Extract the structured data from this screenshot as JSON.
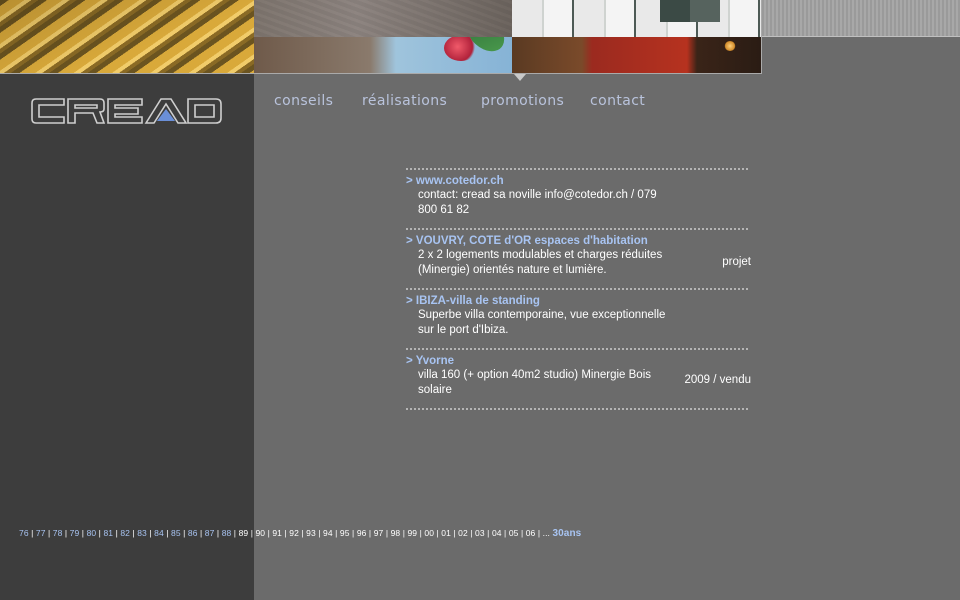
{
  "nav": {
    "items": [
      "conseils",
      "réalisations",
      "promotions",
      "contact"
    ],
    "active": "promotions"
  },
  "logo": {
    "text": "CREAD"
  },
  "entries": [
    {
      "title": "> www.cotedor.ch",
      "text": "contact: cread sa noville info@cotedor.ch / 079 800 61 82",
      "status": ""
    },
    {
      "title": "> VOUVRY, COTE d'OR espaces d'habitation",
      "text": "2 x 2 logements modulables et charges réduites (Minergie) orientés nature et lumière.",
      "status": "projet"
    },
    {
      "title": "> IBIZA-villa de standing",
      "text": "Superbe villa contemporaine, vue exceptionnelle sur le port d'Ibiza.",
      "status": ""
    },
    {
      "title": "> Yvorne",
      "text": "villa 160 (+ option 40m2 studio) Minergie Bois solaire",
      "status": "2009 / vendu"
    }
  ],
  "years": {
    "linked": [
      "76",
      "77",
      "78",
      "79",
      "80",
      "81",
      "82",
      "83",
      "84",
      "85",
      "86",
      "87",
      "88"
    ],
    "plain": [
      "89",
      "90",
      "91",
      "92",
      "93",
      "94",
      "95",
      "96",
      "97",
      "98",
      "99",
      "00",
      "01",
      "02",
      "03",
      "04",
      "05",
      "06"
    ],
    "ellipsis": "...",
    "anniversary": "30ans"
  },
  "colors": {
    "accent": "#a8c4f2",
    "nav": "#b9c3dc",
    "page_bg": "#6b6b6b",
    "left_column": "#3d3d3d"
  }
}
